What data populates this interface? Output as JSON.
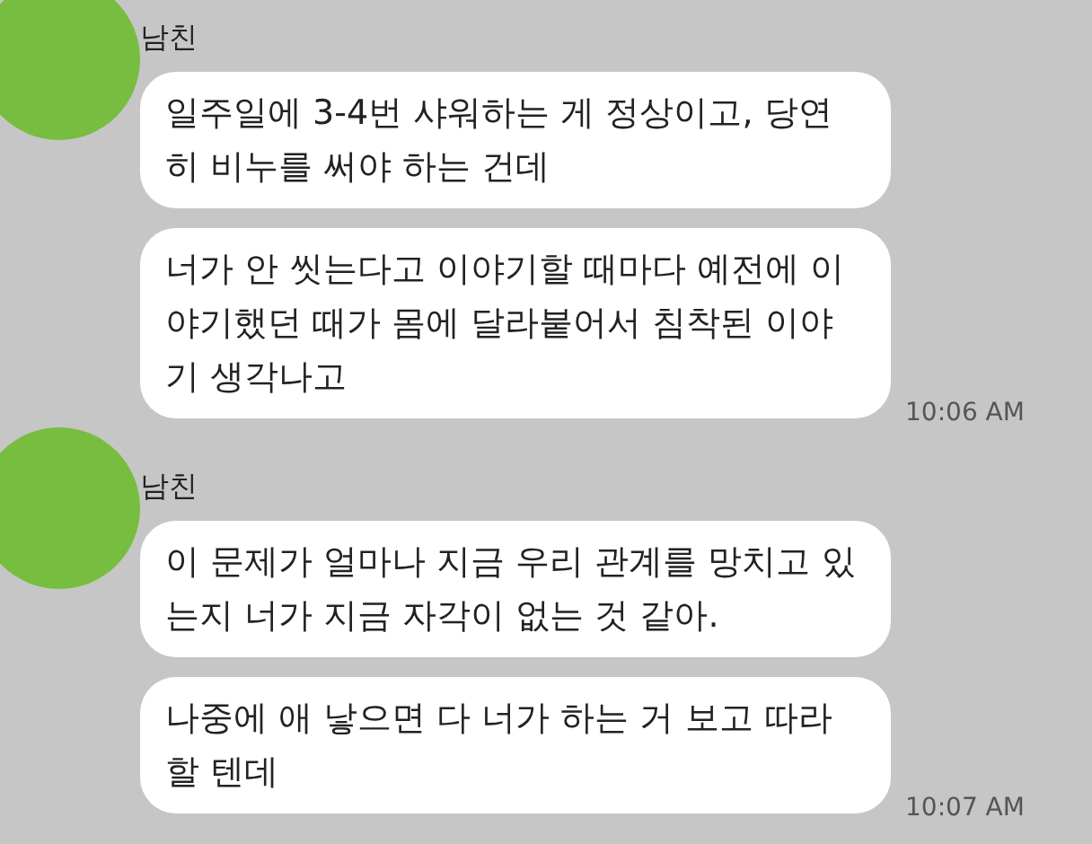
{
  "conversation": [
    {
      "sender": "남친",
      "messages": [
        "일주일에 3-4번 샤워하는 게 정상이고, 당연히 비누를 써야 하는 건데",
        "너가 안 씻는다고 이야기할 때마다 예전에 이야기했던 때가 몸에 달라붙어서 침착된 이야기 생각나고"
      ],
      "time": "10:06 AM"
    },
    {
      "sender": "남친",
      "messages": [
        "이 문제가 얼마나 지금 우리 관계를 망치고 있는지 너가 지금 자각이 없는 것 같아.",
        "나중에 애 낳으면 다 너가 하는 거 보고 따라할 텐데"
      ],
      "time": "10:07 AM"
    }
  ]
}
